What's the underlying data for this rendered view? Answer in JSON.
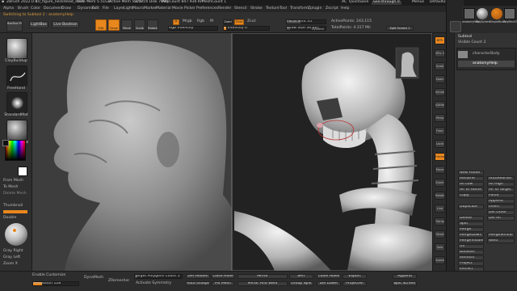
{
  "titlebar": {
    "app": "ZBrush 2022.0.6",
    "file": "10_figure_neckHead_start",
    "free_mem": "Free Mem 5.51GB",
    "active_mem": "Active Mem 5371",
    "scratch": "Scratch Disk 7899",
    "polycount": "PolyCount 847.936 KP",
    "meshcount": "MeshCount 1",
    "ac": "AC",
    "quicksave": "QuickSave",
    "see_through": "See-through 0",
    "menus": "Menus",
    "default_zscript": "DefaultZScript"
  },
  "menubar": {
    "items": [
      "Alpha",
      "Brush",
      "Color",
      "Document",
      "Draw",
      "Dynamics",
      "Edit",
      "File",
      "Layer",
      "Light",
      "Macro",
      "Marker",
      "Material",
      "Movie",
      "Picker",
      "Preferences",
      "Render",
      "Stencil",
      "Stroke",
      "Texture",
      "Tool",
      "Transform",
      "Zplugin",
      "Zscript",
      "Help"
    ]
  },
  "shelf": {
    "switching": "Switching to Subtool 2 : anatomyHelp",
    "box_label": "BoxTool Preview",
    "lightbox": "LightBox",
    "live_boolean": "Live Boolean",
    "edit": "Edit",
    "draw": "Draw",
    "move": "Move",
    "scale": "Scale",
    "rotate": "Rotate",
    "a_label": "A",
    "mrgb": "Mrgb",
    "rgb": "Rgb",
    "m": "M",
    "zadd": "Zadd",
    "zsub": "Zsub",
    "zcut": "Zcut",
    "rgb_intensity": "Rgb Intensity",
    "z_intensity": "Z Intensity 6",
    "focal_shift": "Focal Shift 35",
    "draw_size": "Draw Size 36.467",
    "dynamic": "Dynamic",
    "active_points": "ActivePoints: 243,115",
    "total_points": "TotalPoints: 4.317 Mil",
    "split_screen": "Split Screen 1"
  },
  "left": {
    "tools": [
      "ClayBuildup",
      "FreeHand",
      "StandardMat",
      "BasicMaterial"
    ],
    "from_mesh": "From Mesh",
    "to_mesh": "To Mesh",
    "delete_mesh": "Delete Mesh",
    "thumbnail": "Thumbnail",
    "double": "Double",
    "gray_right": "Gray Right",
    "gray_left": "Gray Left",
    "zoom_x": "Zoom X"
  },
  "right_shelf": {
    "buttons": [
      "BPR",
      "SPix 3",
      "Scroll",
      "Zoom",
      "Actual",
      "AAHalf",
      "Persp",
      "Floor",
      "Local",
      "Frame",
      "Move",
      "Zoom3D",
      "Rotate",
      "Line Fill",
      "Transp",
      "Ghost",
      "Solo",
      "Xpose"
    ]
  },
  "right_panel": {
    "tool_thumbs": [
      "anatomyHelp",
      "PolySphere",
      "SimpleBrush",
      "PolyMesh3D"
    ],
    "subtool_header": "Subtool",
    "visible_count": "Visible Count 2",
    "subtools": [
      "characterBody",
      "anatomyHelp"
    ],
    "list_all": "List All",
    "new_folder": "New Folder",
    "rename": "Rename",
    "auto_reorder": "AutoReorder",
    "all_low": "All Low",
    "all_high": "All High",
    "all_to_home": "All To Home",
    "all_to_target": "All To Target",
    "copy": "Copy",
    "paste": "Paste",
    "append": "Append",
    "duplicate": "Duplicate",
    "insert": "Insert",
    "del_other": "Del Other",
    "delete": "Delete",
    "del_all": "Del All",
    "split": "Split",
    "merge": "Merge",
    "merge_down": "MergeDown",
    "merge_similar": "MergeSimilar",
    "merge_visible": "MergeVisible",
    "weld": "Weld",
    "uv": "Uv",
    "boolean": "Boolean",
    "remesh": "Remesh",
    "project": "Project",
    "extract": "Extract"
  },
  "bottom": {
    "enable_customize": "Enable Customize",
    "resolution": "Resolution 128",
    "dynamesh": "DynaMesh",
    "zremesher": "ZRemesher",
    "target_polygons": "Target Polygons Count 5",
    "activate_symmetry": "Activate Symmetry",
    "del_hidden": "Del Hidden",
    "auto_groups": "Auto Groups",
    "close_holes": "Close Holes",
    "fix_mesh": "Fix Mesh",
    "mirror": "Mirror",
    "mirror_and_weld": "Mirror And Weld",
    "smt": "SMT",
    "group_split": "Group Split",
    "close_holes_2": "Close Holes",
    "del_lower": "Del Lower",
    "export": "Export",
    "append": "Append",
    "split_screen": "Split Screen 1",
    "projection": "ProjectAll"
  },
  "colors": {
    "accent": "#e8871e",
    "panel": "#303030",
    "viewport_left": "#3d3d3d",
    "viewport_right": "#222222"
  }
}
